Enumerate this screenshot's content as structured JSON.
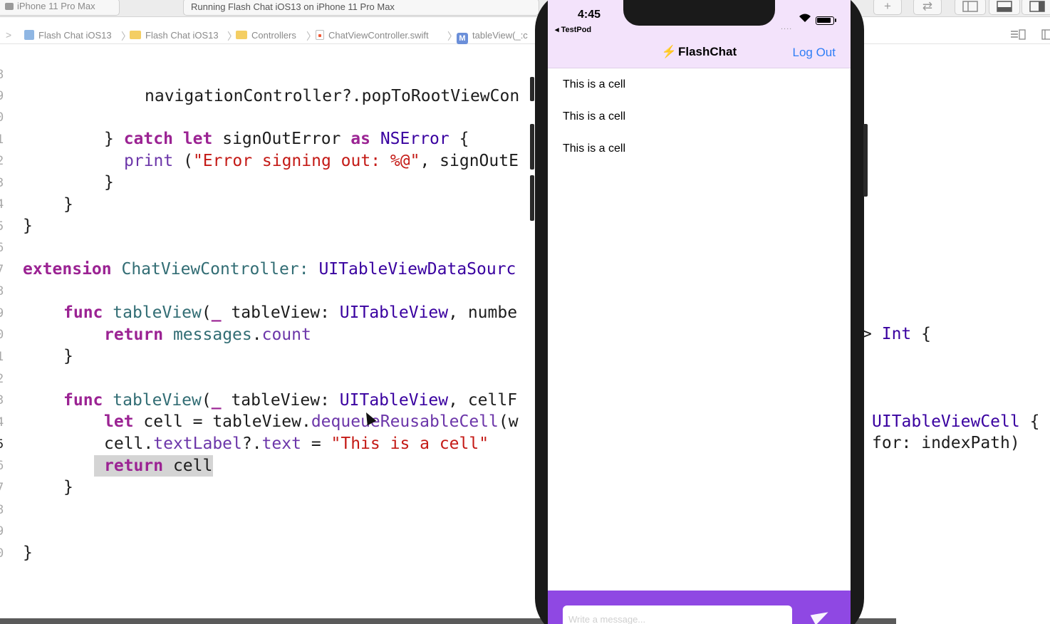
{
  "toolbar": {
    "scheme_device": "iPhone 11 Pro Max",
    "activity_status": "Running Flash Chat iOS13 on iPhone 11 Pro Max",
    "add_button": "+",
    "swap_button": "⇄"
  },
  "jump_bar": {
    "back": ">",
    "items": [
      "Flash Chat iOS13",
      "Flash Chat iOS13",
      "Controllers",
      "ChatViewController.swift",
      "tableView(_:c"
    ]
  },
  "code": {
    "line_numbers": [
      "8",
      "9",
      "0",
      "1",
      "2",
      "3",
      "4",
      "5",
      "6",
      "7",
      "8",
      "9",
      "0",
      "1",
      "2",
      "3",
      "4",
      "5",
      "6",
      "7",
      "8",
      "9",
      "0"
    ],
    "current_line": "5",
    "lines": {
      "l58": "navigationController?.popToRootViewCon",
      "l60_catch": "catch",
      "l60_let": "let",
      "l60_name": "signOutError",
      "l60_as": "as",
      "l60_type": "NSError",
      "l61_print": "print",
      "l61_str": "\"Error signing out: %@\"",
      "l61_rest": "signOutE",
      "l66_ext": "extension",
      "l66_name": "ChatViewController:",
      "l66_proto": "UITableViewDataSourc",
      "l68_func": "func",
      "l68_name": "tableView",
      "l68_param": "tableView:",
      "l68_type": "UITableView",
      "l68_rest": "numbe",
      "l68_tail_arrow": ">",
      "l68_tail_type": "Int",
      "l69_return": "return",
      "l69_messages": "messages",
      "l69_count": "count",
      "l72_func": "func",
      "l72_name": "tableView",
      "l72_param": "tableView:",
      "l72_type": "UITableView",
      "l72_rest": "cellF",
      "l72_tail_type": "UITableViewCell",
      "l73_let": "let",
      "l73_rest": "cell = tableView.",
      "l73_method": "dequeueReusableCell",
      "l73_paren": "(w",
      "l73_tail": "for: indexPath)",
      "l74_cell": "cell.",
      "l74_label": "textLabel",
      "l74_q": "?.",
      "l74_text": "text",
      "l74_eq": " = ",
      "l74_str": "\"This is a cell\"",
      "l75_return": "return",
      "l75_cell": "cell"
    }
  },
  "simulator": {
    "time": "4:45",
    "back_app": "◂ TestPod",
    "signal": "....",
    "wifi": "≋",
    "nav_title": "FlashChat",
    "bolt": "⚡",
    "logout": "Log Out",
    "cells": [
      "This is a cell",
      "This is a cell",
      "This is a cell"
    ],
    "message_placeholder": "Write a message...",
    "colors": {
      "nav_bar": "#f3e3fb",
      "composer": "#8f48e3",
      "accent": "#2f7ef6"
    }
  }
}
